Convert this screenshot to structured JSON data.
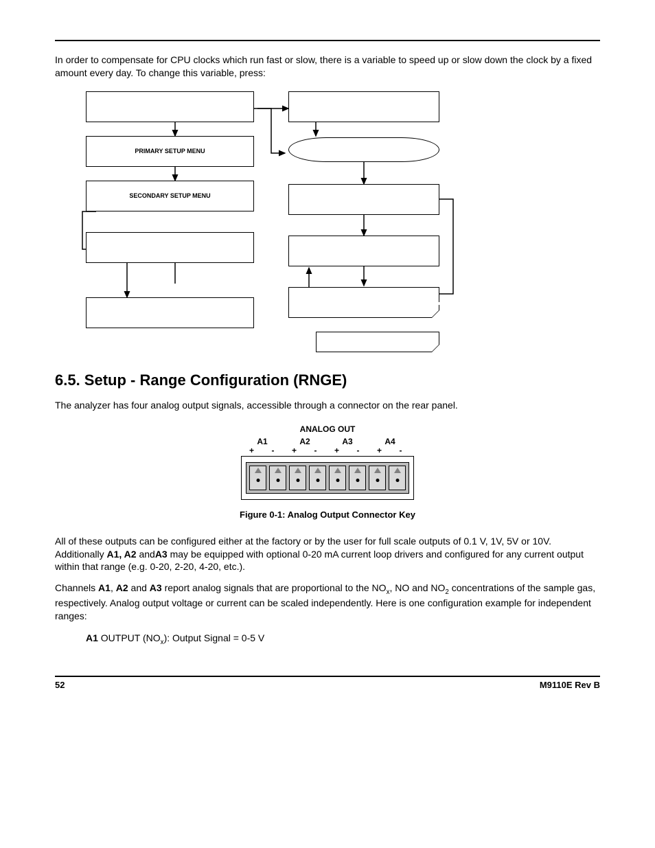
{
  "intro": "In order to compensate for CPU clocks which run fast or slow, there is a variable to speed up or slow down the clock by a fixed amount every day. To change this variable, press:",
  "flow": {
    "primary": "PRIMARY SETUP MENU",
    "secondary": "SECONDARY SETUP MENU"
  },
  "section_heading": "6.5. Setup - Range Configuration (RNGE)",
  "section_p1": "The analyzer has four analog output signals, accessible through a connector on the rear panel.",
  "connector": {
    "title": "ANALOG OUT",
    "channels": [
      "A1",
      "A2",
      "A3",
      "A4"
    ],
    "plus": "+",
    "minus": "-"
  },
  "figure_caption": "Figure 0-1:   Analog Output Connector Key",
  "p_outputs_a": "All of these outputs can be configured either at the factory or by the user for full scale outputs of 0.1 V, 1V, 5V or 10V. Additionally ",
  "p_outputs_bold1": "A1, A2 ",
  "p_outputs_b": "and",
  "p_outputs_bold2": "A3",
  "p_outputs_c": " may be equipped with optional 0-20 mA current loop drivers and configured for any current output within that range (e.g. 0-20, 2-20, 4-20, etc.).",
  "p_channels_a": "Channels ",
  "p_channels_b1": "A1",
  "p_channels_sep": ", ",
  "p_channels_b2": "A2",
  "p_channels_and": " and ",
  "p_channels_b3": "A3",
  "p_channels_c": " report analog signals that are proportional to the NO",
  "p_channels_d": ", NO and NO",
  "p_channels_e": " concentrations of the sample gas, respectively. Analog output voltage or current can be scaled independently. Here is one configuration example for independent ranges:",
  "example_label": "A1",
  "example_text_a": " OUTPUT (NO",
  "example_text_b": "): Output Signal = 0-5 V",
  "sub_x": "x",
  "sub_2": "2",
  "footer_page": "52",
  "footer_rev": "M9110E Rev B"
}
